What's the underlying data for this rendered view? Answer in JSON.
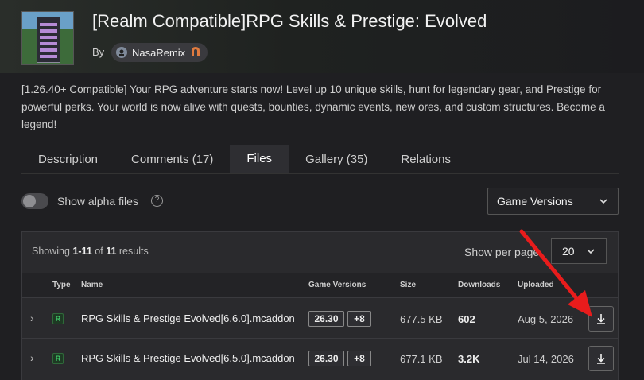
{
  "project": {
    "title": "[Realm Compatible]RPG Skills & Prestige: Evolved",
    "by_label": "By",
    "author": "NasaRemix",
    "description": "[1.26.40+ Compatible] Your RPG adventure starts now! Level up 10 unique skills, hunt for legendary gear, and Prestige for powerful perks. Your world is now alive with quests, bounties, dynamic events, new ores, and custom structures. Become a legend!"
  },
  "tabs": [
    {
      "label": "Description",
      "active": false
    },
    {
      "label": "Comments (17)",
      "active": false
    },
    {
      "label": "Files",
      "active": true
    },
    {
      "label": "Gallery (35)",
      "active": false
    },
    {
      "label": "Relations",
      "active": false
    }
  ],
  "filters": {
    "alpha_label": "Show alpha files",
    "alpha_enabled": false,
    "help_glyph": "?",
    "game_versions_label": "Game Versions"
  },
  "results": {
    "showing_prefix": "Showing",
    "range": "1-11",
    "of_label": "of",
    "total": "11",
    "results_label": "results",
    "per_page_label": "Show per page",
    "per_page_value": "20"
  },
  "columns": {
    "type": "Type",
    "name": "Name",
    "game_versions": "Game Versions",
    "size": "Size",
    "downloads": "Downloads",
    "uploaded": "Uploaded"
  },
  "files": [
    {
      "type": "R",
      "name": "RPG Skills & Prestige Evolved[6.6.0].mcaddon",
      "version": "26.30",
      "more": "+8",
      "size": "677.5 KB",
      "downloads": "602",
      "uploaded": "Aug 5, 2026"
    },
    {
      "type": "R",
      "name": "RPG Skills & Prestige Evolved[6.5.0].mcaddon",
      "version": "26.30",
      "more": "+8",
      "size": "677.1 KB",
      "downloads": "3.2K",
      "uploaded": "Jul 14, 2026"
    }
  ],
  "colors": {
    "accent": "#f16436",
    "release_green": "#3fcf6a",
    "annotation_arrow": "#e81c1c"
  }
}
